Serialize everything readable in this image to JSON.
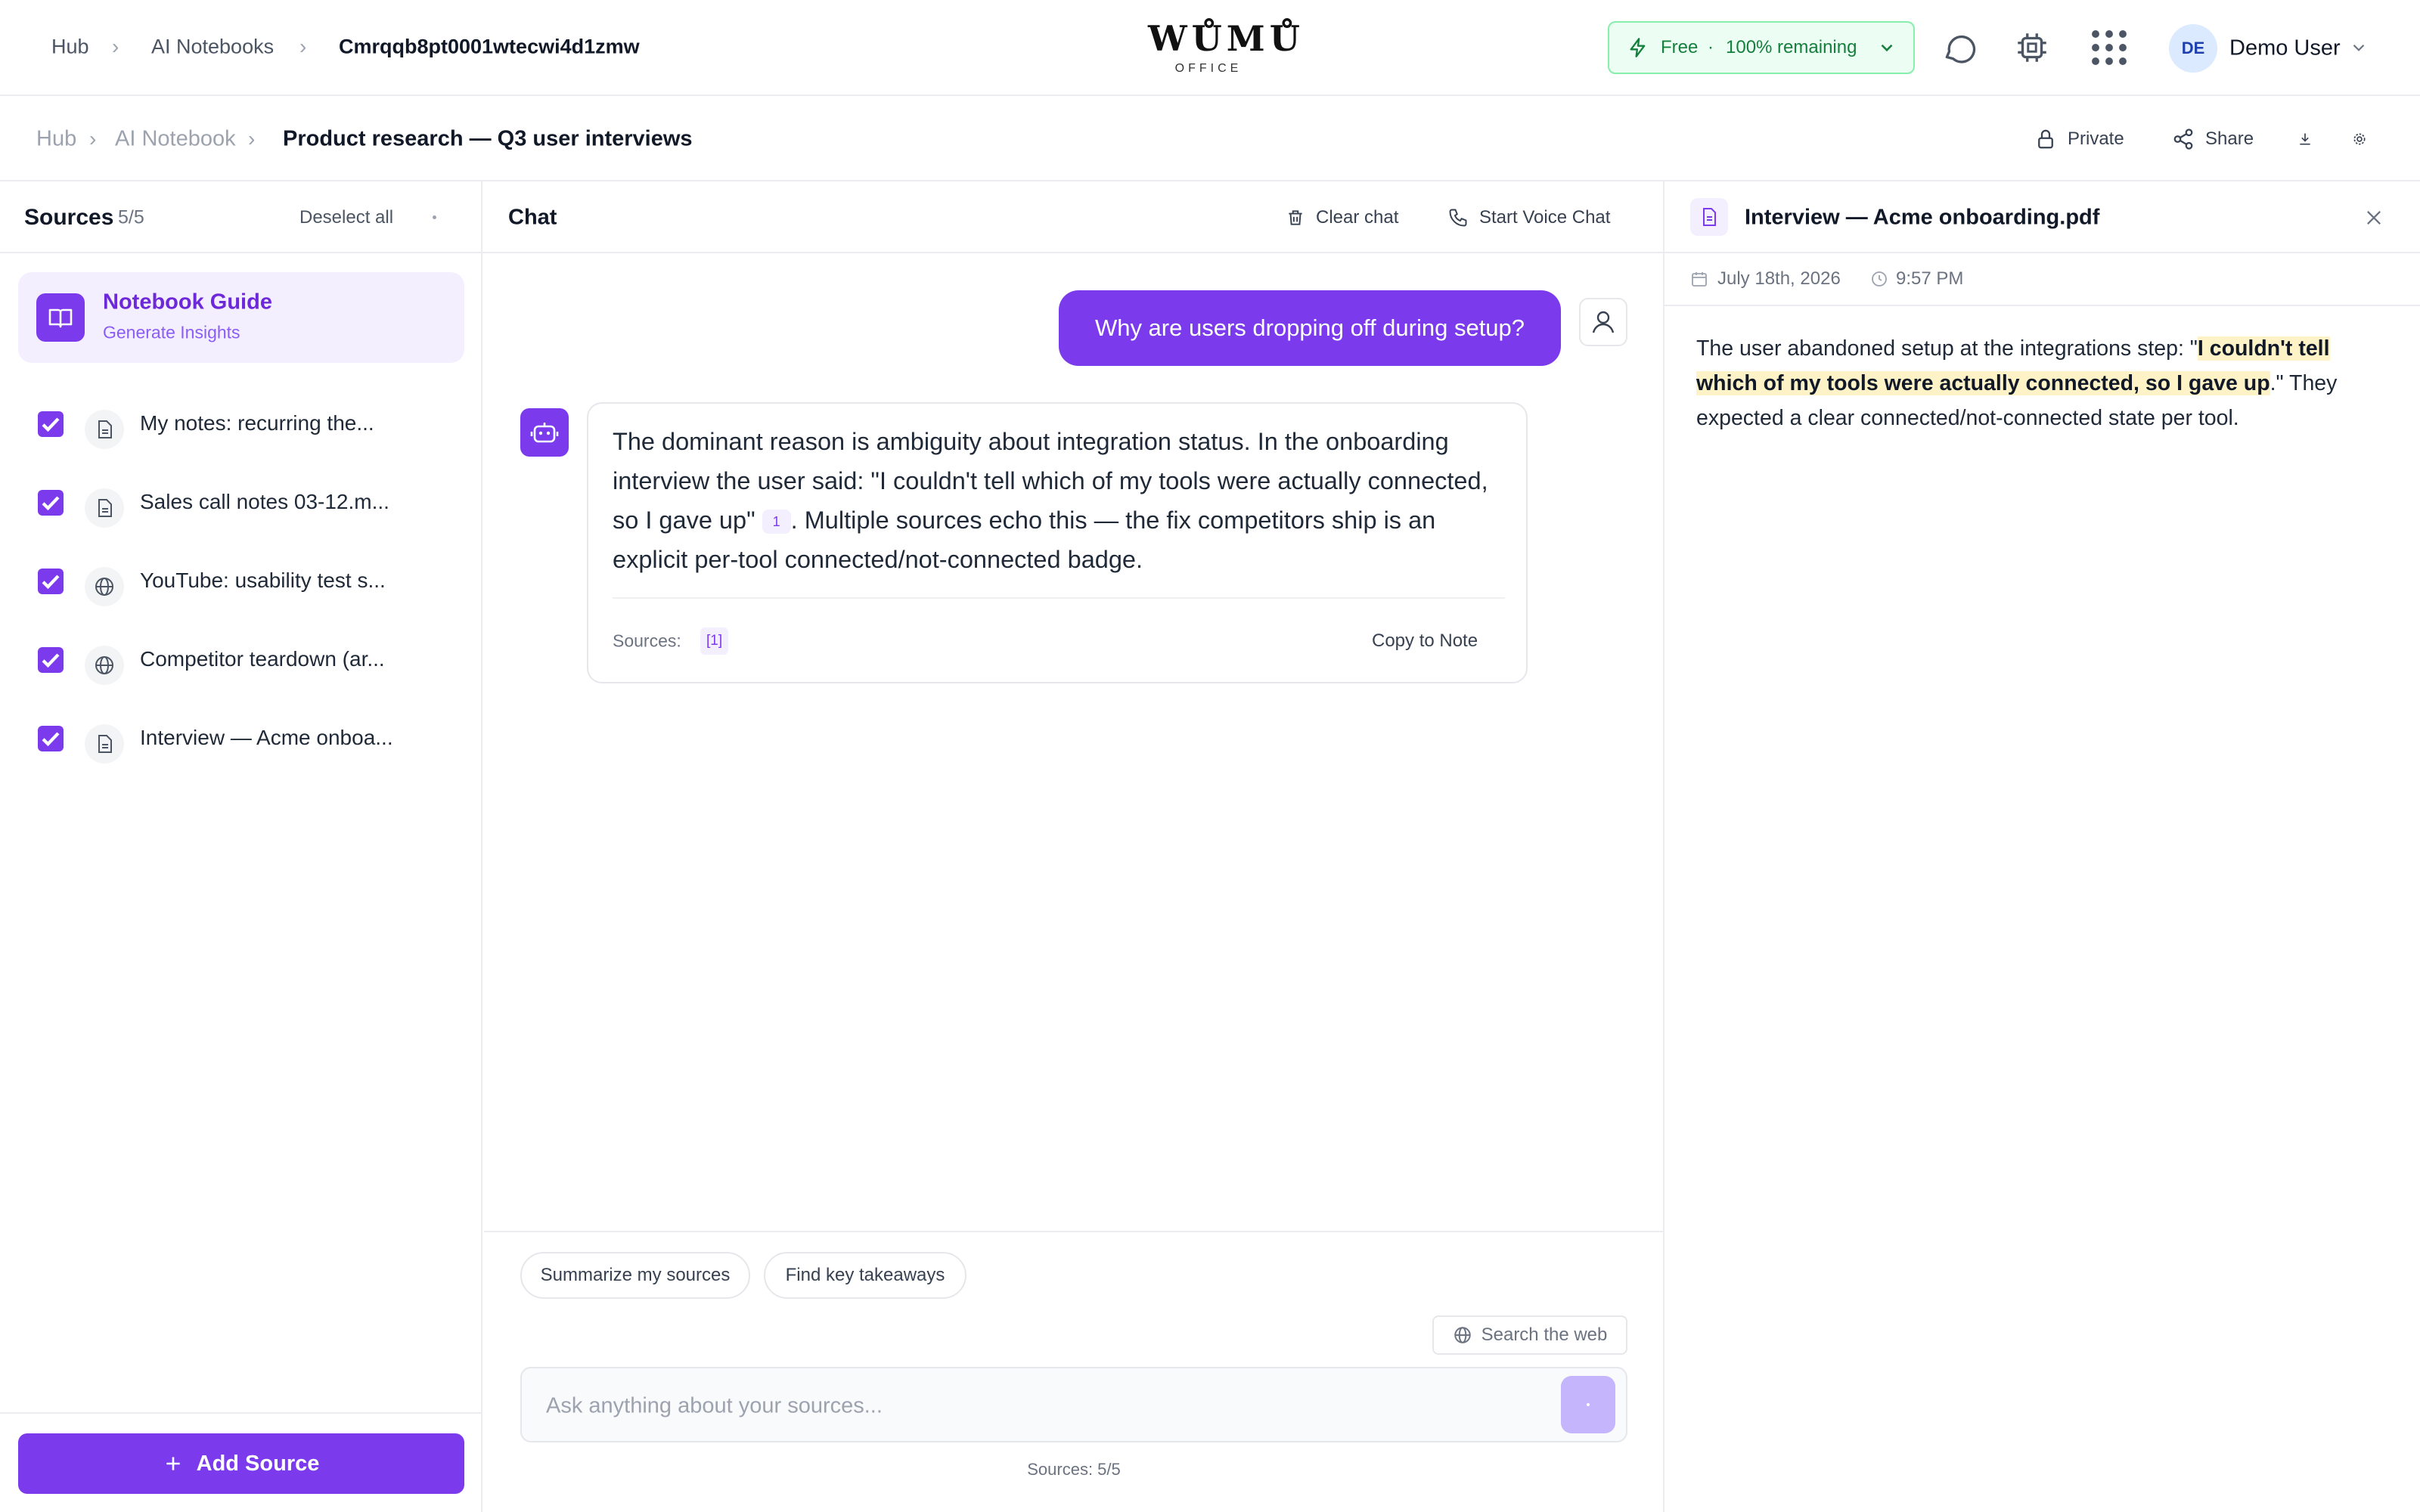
{
  "topbar": {
    "breadcrumb": [
      "Hub",
      "AI Notebooks",
      "Cmrqqb8pt0001wtecwi4d1zmw"
    ],
    "logo": "WŮMŮ",
    "logo_sub": "OFFICE",
    "plan": {
      "label": "Free",
      "dot": "·",
      "remaining": "100% remaining"
    },
    "user": {
      "initials": "DE",
      "name": "Demo User"
    }
  },
  "subbar": {
    "breadcrumb": [
      "Hub",
      "AI Notebook",
      "Product research — Q3 user interviews"
    ],
    "actions": {
      "private": "Private",
      "share": "Share"
    }
  },
  "sources": {
    "title": "Sources",
    "count": "5/5",
    "deselect": "Deselect all",
    "guide": {
      "title": "Notebook Guide",
      "subtitle": "Generate Insights"
    },
    "items": [
      {
        "title": "My notes: recurring the...",
        "icon": "document-icon",
        "checked": true
      },
      {
        "title": "Sales call notes 03-12.m...",
        "icon": "document-icon",
        "checked": true
      },
      {
        "title": "YouTube: usability test s...",
        "icon": "globe-icon",
        "checked": true
      },
      {
        "title": "Competitor teardown (ar...",
        "icon": "globe-icon",
        "checked": true
      },
      {
        "title": "Interview — Acme onboa...",
        "icon": "document-icon",
        "checked": true
      }
    ],
    "add_button": "Add Source"
  },
  "chat": {
    "title": "Chat",
    "clear": "Clear chat",
    "voice": "Start Voice Chat",
    "user_message": "Why are users dropping off during setup?",
    "bot_message": {
      "part1": "The dominant reason is ambiguity about integration status. In the onboarding interview the user said: \"I couldn't tell which of my tools were actually connected, so I gave up\"",
      "citation": "1",
      "part2": ". Multiple sources echo this — the fix competitors ship is an explicit per-tool connected/not-connected badge."
    },
    "sources_label": "Sources:",
    "sources_ref": "[1]",
    "copy_to_note": "Copy to Note",
    "suggestions": [
      "Summarize my sources",
      "Find key takeaways"
    ],
    "search_web": "Search the web",
    "input_placeholder": "Ask anything about your sources...",
    "footer": "Sources: 5/5"
  },
  "viewer": {
    "title": "Interview — Acme onboarding.pdf",
    "date": "July 18th, 2026",
    "time": "9:57 PM",
    "text_before": "The user abandoned setup at the integrations step: \"",
    "highlight": "I couldn't tell which of my tools were actually connected, so I gave up",
    "text_after": ".\" They expected a clear connected/not-connected state per tool."
  },
  "colors": {
    "accent": "#7c3aed",
    "plan_green": "#15803d",
    "highlight": "#fef3c7"
  }
}
